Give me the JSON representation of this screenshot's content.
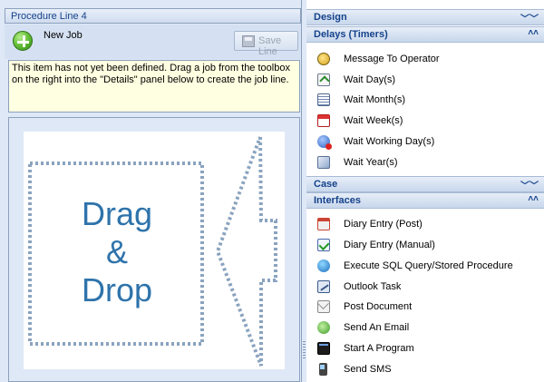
{
  "left_panel": {
    "title": "Procedure Line 4",
    "new_job_label": "New Job",
    "save_line_label": "Save Line",
    "info_message": "This item has not yet been defined. Drag a job from the toolbox on the right into the \"Details\" panel below to create the job line.",
    "drop_zone": {
      "line1": "Drag",
      "line2": "&",
      "line3": "Drop"
    }
  },
  "toolbox": {
    "groups": [
      {
        "title": "Design",
        "expanded": false,
        "chevron": "collapsed-double-chevron-icon",
        "items": []
      },
      {
        "title": "Delays (Timers)",
        "expanded": true,
        "chevron": "expanded-double-chevron-icon",
        "items": [
          {
            "label": "Message To Operator",
            "icon": "operator-icon"
          },
          {
            "label": "Wait Day(s)",
            "icon": "calendar-day-icon"
          },
          {
            "label": "Wait Month(s)",
            "icon": "calendar-month-icon"
          },
          {
            "label": "Wait Week(s)",
            "icon": "calendar-week-icon"
          },
          {
            "label": "Wait Working Day(s)",
            "icon": "working-day-icon"
          },
          {
            "label": "Wait Year(s)",
            "icon": "calendar-year-icon"
          }
        ]
      },
      {
        "title": "Case",
        "expanded": false,
        "chevron": "collapsed-double-chevron-icon",
        "items": []
      },
      {
        "title": "Interfaces",
        "expanded": true,
        "chevron": "expanded-double-chevron-icon",
        "items": [
          {
            "label": "Diary Entry (Post)",
            "icon": "diary-post-icon"
          },
          {
            "label": "Diary Entry (Manual)",
            "icon": "diary-manual-icon"
          },
          {
            "label": "Execute SQL Query/Stored Procedure",
            "icon": "sql-icon"
          },
          {
            "label": "Outlook Task",
            "icon": "outlook-task-icon"
          },
          {
            "label": "Post Document",
            "icon": "post-document-icon"
          },
          {
            "label": "Send An Email",
            "icon": "email-icon"
          },
          {
            "label": "Start A Program",
            "icon": "program-icon"
          },
          {
            "label": "Send SMS",
            "icon": "sms-icon"
          }
        ]
      }
    ]
  },
  "colors": {
    "panel_bg": "#dfe8f6",
    "header_text": "#15428b",
    "info_bg": "#ffffe1",
    "dnd_accent": "#2e73ab",
    "dnd_border": "#8aa3bf"
  }
}
